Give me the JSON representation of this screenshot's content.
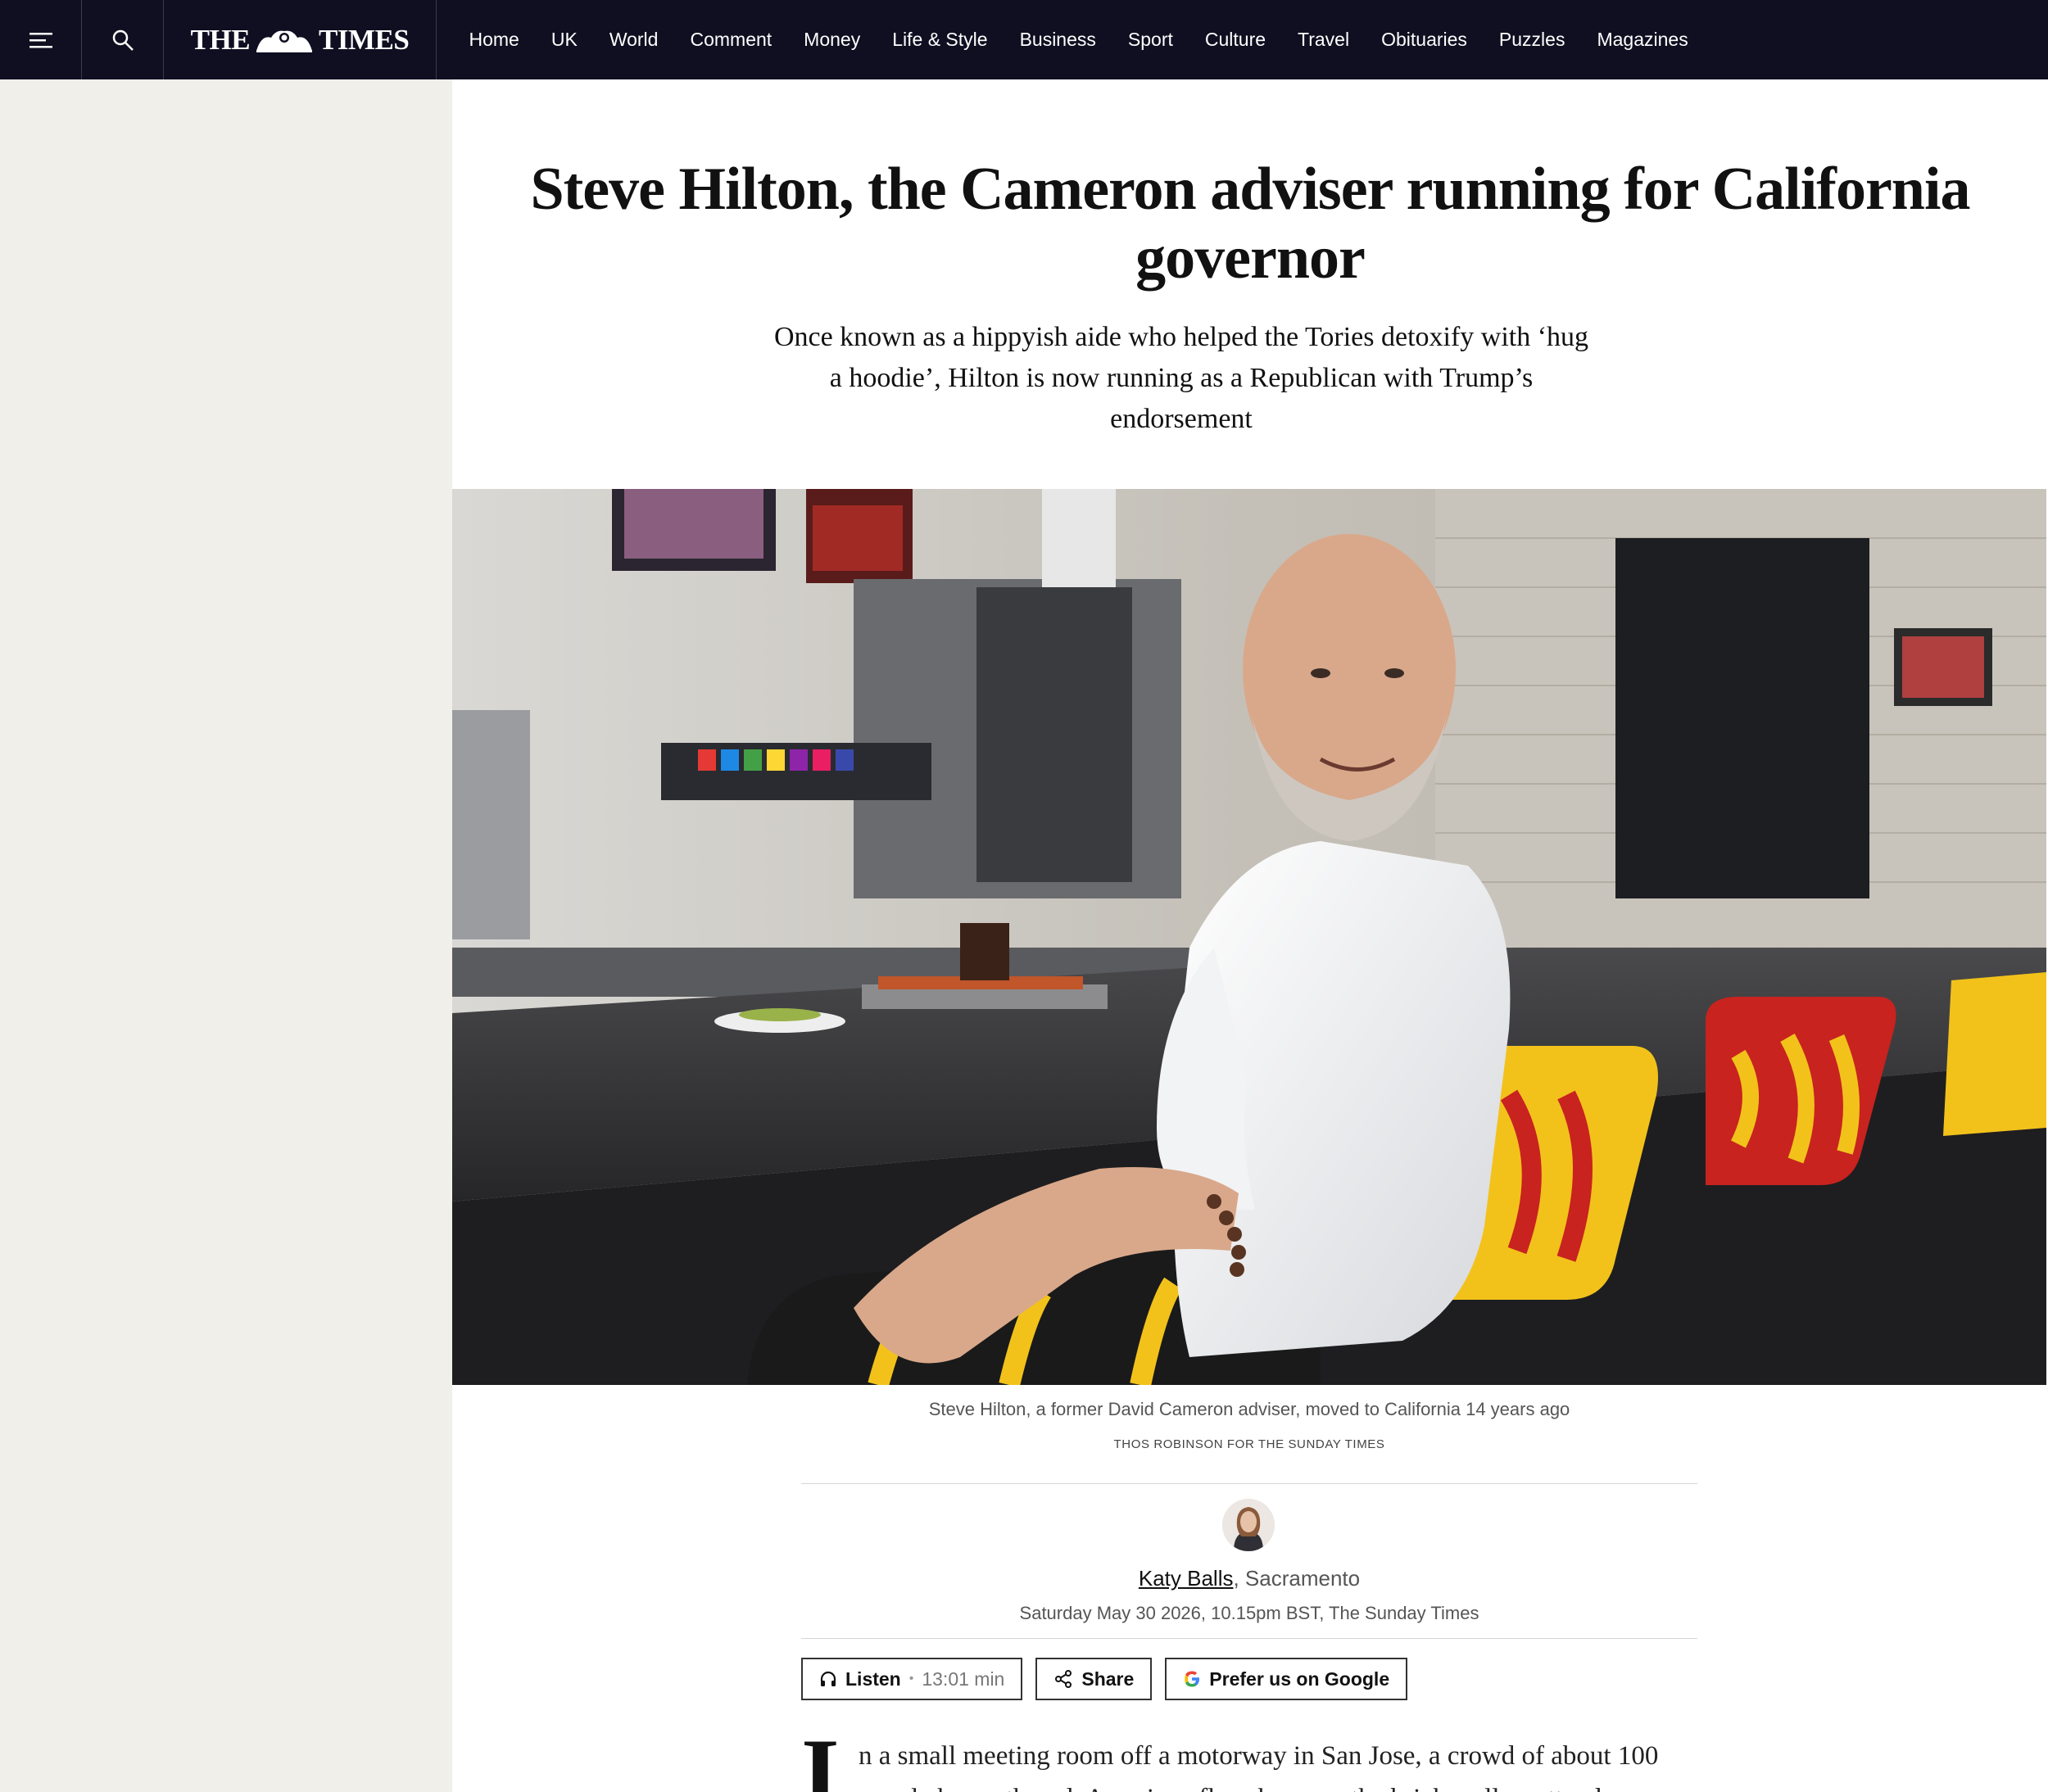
{
  "nav": {
    "logo_text_left": "THE",
    "logo_text_right": "TIMES",
    "items": [
      "Home",
      "UK",
      "World",
      "Comment",
      "Money",
      "Life & Style",
      "Business",
      "Sport",
      "Culture",
      "Travel",
      "Obituaries",
      "Puzzles",
      "Magazines"
    ]
  },
  "article": {
    "headline": "Steve Hilton, the Cameron adviser running for California governor",
    "standfirst": "Once known as a hippyish aide who helped the Tories detoxify with ‘hug a hoodie’, Hilton is now running as a Republican with Trump’s endorsement",
    "caption": "Steve Hilton, a former David Cameron adviser, moved to California 14 years ago",
    "credit": "THOS ROBINSON FOR THE SUNDAY TIMES",
    "author": "Katy Balls",
    "location": ", Sacramento",
    "dateline": "Saturday May 30 2026, 10.15pm BST, The Sunday Times",
    "dropcap": "I",
    "body_line_1": "n a small meeting room off a motorway in San Jose, a crowd of about 100",
    "body_line_2": "people has gathered. American flags hang on the brick wall as attendees"
  },
  "actions": {
    "listen_label": "Listen",
    "listen_separator": "•",
    "listen_duration": "13:01 min",
    "share_label": "Share",
    "google_label": "Prefer us on Google"
  },
  "colors": {
    "nav_bg": "#0f0f21",
    "sidebar_bg": "#f1efea",
    "text": "#111111"
  },
  "icons": [
    "menu-icon",
    "search-icon",
    "headphones-icon",
    "share-icon",
    "google-icon"
  ]
}
